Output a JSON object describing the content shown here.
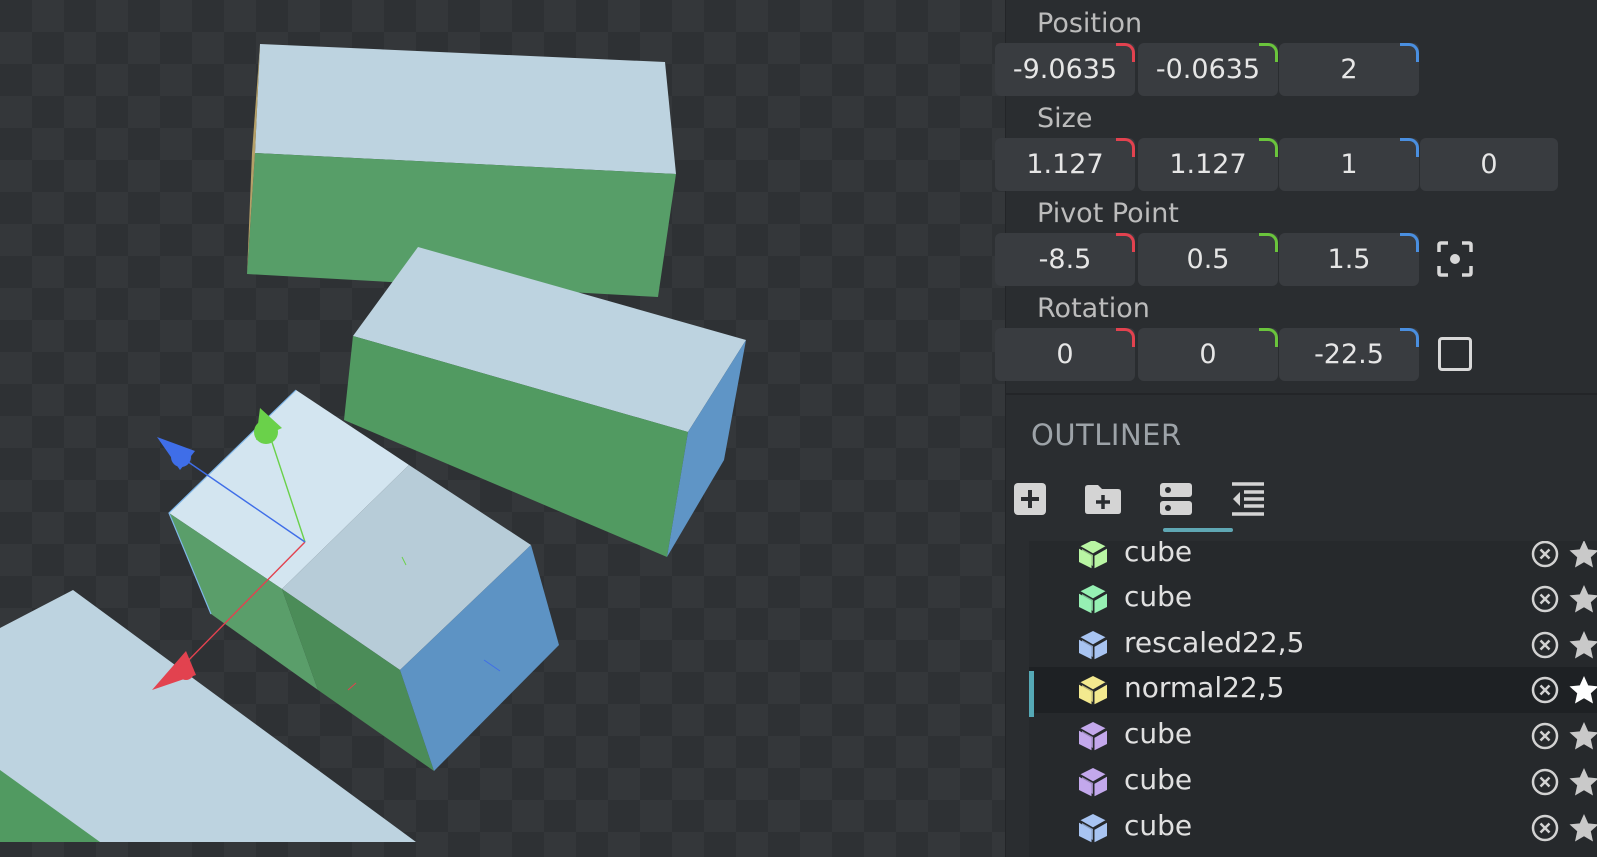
{
  "properties": {
    "position": {
      "label": "Position",
      "values": [
        "-9.0635",
        "-0.0635",
        "2"
      ]
    },
    "size": {
      "label": "Size",
      "values": [
        "1.127",
        "1.127",
        "1",
        "0"
      ]
    },
    "pivot": {
      "label": "Pivot Point",
      "values": [
        "-8.5",
        "0.5",
        "1.5"
      ]
    },
    "rotation": {
      "label": "Rotation",
      "values": [
        "0",
        "0",
        "-22.5"
      ]
    }
  },
  "axis_colors": {
    "x": "#e2424f",
    "y": "#6ac43c",
    "z": "#4a8fe0"
  },
  "outliner": {
    "title": "OUTLINER",
    "toolbar": [
      "add-cube-icon",
      "add-group-icon",
      "toggle-details-icon",
      "collapse-all-icon"
    ],
    "items": [
      {
        "name": "cube",
        "color": "#b9f5a3",
        "selected": false
      },
      {
        "name": "cube",
        "color": "#96f0b3",
        "selected": false
      },
      {
        "name": "rescaled22,5",
        "color": "#a8c4f2",
        "selected": false
      },
      {
        "name": "normal22,5",
        "color": "#f3e98f",
        "selected": true
      },
      {
        "name": "cube",
        "color": "#c3a8ec",
        "selected": false
      },
      {
        "name": "cube",
        "color": "#c3a8ec",
        "selected": false
      },
      {
        "name": "cube",
        "color": "#a8c4f2",
        "selected": false
      }
    ]
  },
  "colors": {
    "accent": "#5fa7b4",
    "cube_top": "#bdd5e2",
    "cube_side": "#559e64",
    "cube_blue": "#5d93c4"
  }
}
